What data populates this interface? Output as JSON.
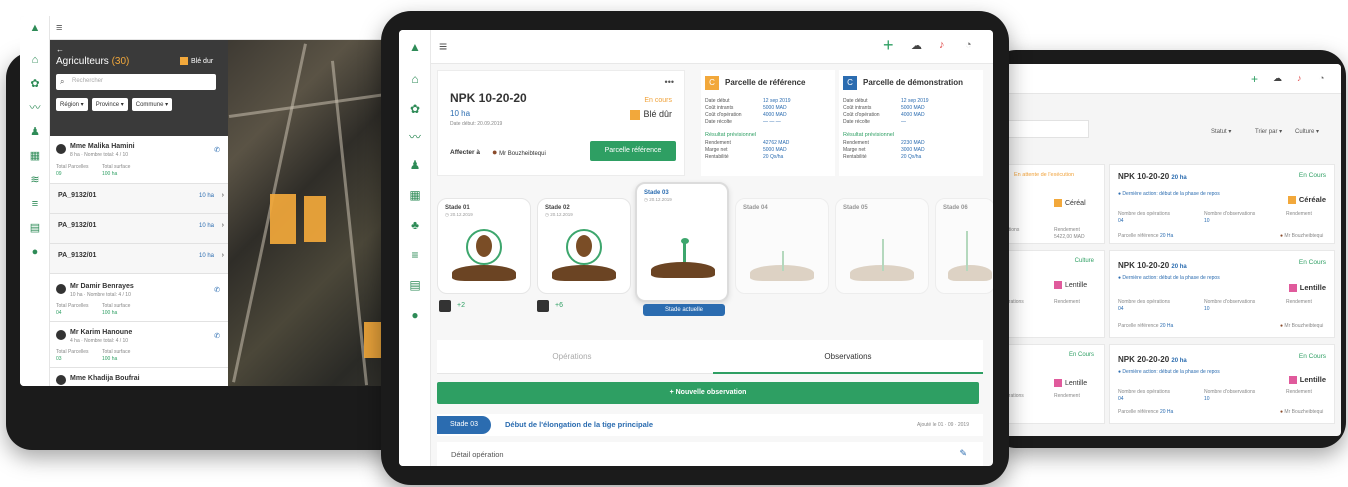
{
  "left": {
    "back_arrow": "←",
    "title": "Agriculteurs",
    "count": "(30)",
    "crop_badge": "Blé dur",
    "search_placeholder": "Rechercher",
    "filters": [
      "Région ▾",
      "Province ▾",
      "Commune ▾"
    ],
    "farmers": [
      {
        "name": "Mme Malika Hamini",
        "sub": "8 ha · Nombre total: 4 / 10",
        "col1_label": "Total Parcelles",
        "col1_val": "09",
        "col2_label": "Total surface",
        "col2_val": "100 ha"
      },
      {
        "name": "Mr Damir Benrayes",
        "sub": "10 ha · Nombre total: 4 / 10",
        "col1_label": "Total Parcelles",
        "col1_val": "04",
        "col2_label": "Total surface",
        "col2_val": "100 ha"
      },
      {
        "name": "Mr Karim Hanoune",
        "sub": "4 ha · Nombre total: 4 / 10",
        "col1_label": "Total Parcelles",
        "col1_val": "03",
        "col2_label": "Total surface",
        "col2_val": "100 ha"
      },
      {
        "name": "Mme Khadija Boufrai",
        "sub": "",
        "col1_label": "",
        "col1_val": "",
        "col2_label": "",
        "col2_val": ""
      }
    ],
    "parcels": [
      {
        "name": "PA_9132/01",
        "ha": "10 ha"
      },
      {
        "name": "PA_9132/01",
        "ha": "10 ha"
      },
      {
        "name": "PA_9132/01",
        "ha": "10 ha"
      }
    ]
  },
  "center": {
    "header": {
      "code": "NPK 10-20-20",
      "area": "10 ha",
      "status": "En cours",
      "crop": "Blé dûr",
      "dates": "Date début: 20.09.2019",
      "assign_label": "Affecter à",
      "assignee": "Mr Bouzheibtequi",
      "ref_button": "Parcelle référence",
      "more": "•••"
    },
    "ref_panel": {
      "badge": "C",
      "title": "Parcelle de référence",
      "rows": [
        [
          "Date début",
          "12 sep 2019"
        ],
        [
          "Coût intrants",
          "5000 MAD"
        ],
        [
          "Coût d'opération",
          "4000 MAD"
        ],
        [
          "Date récolte",
          "— — —"
        ]
      ],
      "result_title": "Résultat prévisionnel",
      "results": [
        [
          "Rendement",
          "42762 MAD"
        ],
        [
          "Marge net",
          "5000 MAD"
        ],
        [
          "Rentabilité",
          "20 Qx/ha"
        ]
      ]
    },
    "demo_panel": {
      "badge": "C",
      "title": "Parcelle de démonstration",
      "rows": [
        [
          "Date début",
          "12 sep 2019"
        ],
        [
          "Coût intrants",
          "5000 MAD"
        ],
        [
          "Coût d'opération",
          "4000 MAD"
        ],
        [
          "Date récolte",
          "—"
        ]
      ],
      "result_title": "Résultat prévisionnel",
      "results": [
        [
          "Rendement",
          "2230 MAD"
        ],
        [
          "Marge net",
          "3000 MAD"
        ],
        [
          "Rentabilité",
          "20 Qx/ha"
        ]
      ]
    },
    "stages": [
      {
        "title": "Stade 01",
        "date": "20.12.2019",
        "extra": "+2"
      },
      {
        "title": "Stade 02",
        "date": "20.12.2019",
        "extra": "+6"
      },
      {
        "title": "Stade 03",
        "date": "20.12.2019",
        "current_label": "Stade actuelle"
      },
      {
        "title": "Stade 04",
        "date": ""
      },
      {
        "title": "Stade 05",
        "date": ""
      },
      {
        "title": "Stade 06",
        "date": ""
      }
    ],
    "tabs": [
      "Opérations",
      "Observations"
    ],
    "new_observation": "+ Nouvelle observation",
    "observation": {
      "stage": "Stade 03",
      "title": "Début de l'élongation de la tige principale",
      "date": "Ajouté le 01 · 09 · 2019"
    },
    "detail": "Détail opération"
  },
  "right": {
    "filters": [
      "Statut ▾",
      "Trier par ▾",
      "Culture ▾"
    ],
    "cards": [
      {
        "code": "NPK 10-20-20",
        "ha": "20 ha",
        "status": "En Cours",
        "alert": "Dernière action: début de la phase de repos",
        "crop": "Céréale",
        "crop_color": "#f2a83b",
        "ops_label": "Nombre des opérations",
        "ops": "04",
        "obs_label": "Nombre d'observations",
        "obs": "10",
        "yield_label": "Rendement",
        "ref": "Parcelle référence",
        "ref_val": "20 Ha",
        "owner": "Mr Bouzheibtequi"
      },
      {
        "code": "NPK 10-20-20",
        "ha": "20 ha",
        "status": "En Cours",
        "alert": "Dernière action: début de la phase de repos",
        "crop": "Lentille",
        "crop_color": "#e05a9c",
        "ops_label": "Nombre des opérations",
        "ops": "04",
        "obs_label": "Nombre d'observations",
        "obs": "10",
        "yield_label": "Rendement",
        "ref": "Parcelle référence",
        "ref_val": "20 Ha",
        "owner": "Mr Bouzheibtequi"
      },
      {
        "code": "NPK 20-20-20",
        "ha": "20 ha",
        "status": "En Cours",
        "alert": "Dernière action: début de la phase de repos",
        "crop": "Lentille",
        "crop_color": "#e05a9c",
        "ops_label": "Nombre des opérations",
        "ops": "04",
        "obs_label": "Nombre d'observations",
        "obs": "10",
        "yield_label": "Rendement",
        "ref": "Parcelle référence",
        "ref_val": "20 Ha",
        "owner": "Mr Bouzheibtequi"
      }
    ],
    "partial": [
      {
        "status": "En attente de l'exécution",
        "crop": "Céréal",
        "crop_color": "#f2a83b",
        "a": "ations",
        "b": "Rendement",
        "c": "5422,00 MAD"
      },
      {
        "status": "Culture",
        "crop": "Lentille",
        "crop_color": "#e05a9c",
        "a": "érations",
        "b": "Rendement",
        "c": "10"
      },
      {
        "status": "En Cours",
        "crop": "Lentille",
        "crop_color": "#e05a9c",
        "a": "érations",
        "b": "Rendement",
        "c": "10"
      }
    ]
  },
  "colors": {
    "brand_green": "#2e9f63",
    "orange": "#f2a83b",
    "blue": "#2b6cb0",
    "pink": "#e05a9c"
  }
}
